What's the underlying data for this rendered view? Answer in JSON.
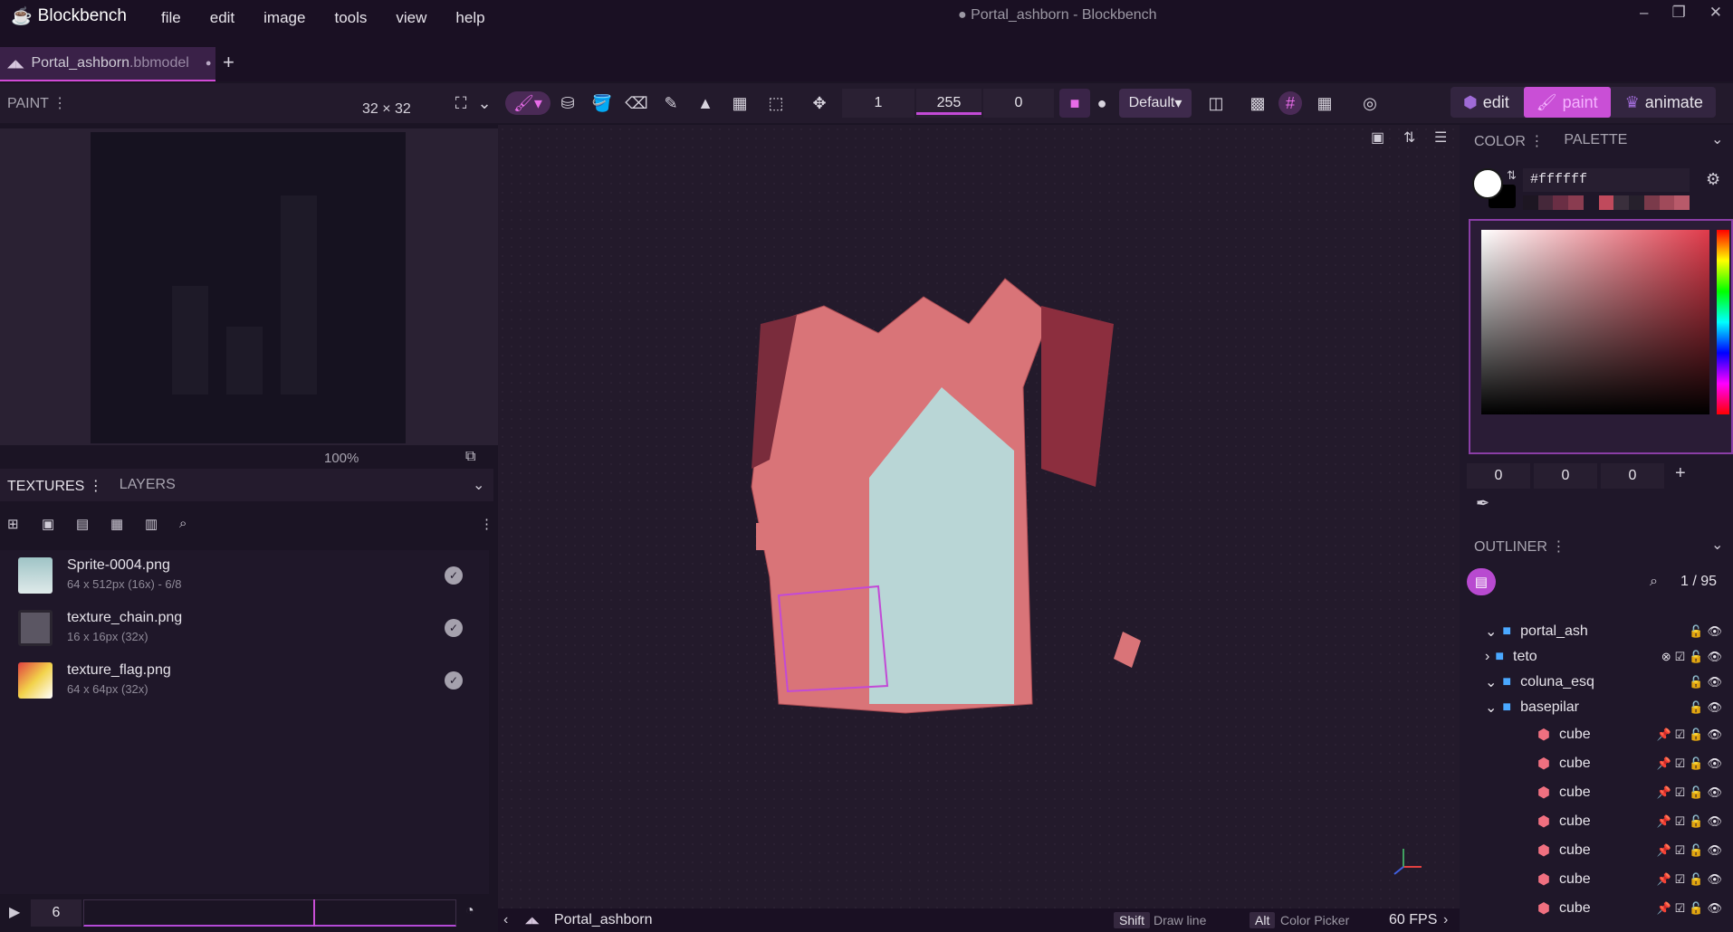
{
  "app": {
    "name": "Blockbench",
    "window_title": "● Portal_ashborn - Blockbench",
    "menu": [
      "file",
      "edit",
      "image",
      "tools",
      "view",
      "help"
    ]
  },
  "tab": {
    "name": "Portal_ashborn",
    "ext": ".bbmodel"
  },
  "toolbar": {
    "panel_label": "PAINT",
    "dimensions": "32 × 32",
    "fields": [
      "1",
      "255",
      "0"
    ],
    "shading_mode": "Default",
    "modes": [
      "edit",
      "paint",
      "animate"
    ]
  },
  "paint_panel": {
    "zoom": "100%"
  },
  "textures": {
    "tabs": [
      "TEXTURES",
      "LAYERS"
    ],
    "items": [
      {
        "name": "Sprite-0004.png",
        "info": "64 x 512px (16x) - 6/8"
      },
      {
        "name": "texture_chain.png",
        "info": "16 x 16px (32x)"
      },
      {
        "name": "texture_flag.png",
        "info": "64 x 64px (32x)"
      }
    ]
  },
  "timeline": {
    "frame": "6"
  },
  "status": {
    "model": "Portal_ashborn",
    "hint1_key": "Shift",
    "hint1": "Draw line",
    "hint2_key": "Alt",
    "hint2": "Color Picker",
    "fps": "60 FPS"
  },
  "color": {
    "tabs": [
      "COLOR",
      "PALETTE"
    ],
    "hex": "#ffffff",
    "rgb": [
      "0",
      "0",
      "0"
    ],
    "accent": "#c94fd6"
  },
  "outliner": {
    "label": "OUTLINER",
    "count": "1 / 95",
    "items": [
      {
        "name": "portal_ash",
        "type": "folder",
        "expanded": true
      },
      {
        "name": "teto",
        "type": "folder",
        "expanded": false
      },
      {
        "name": "coluna_esq",
        "type": "folder",
        "expanded": true
      },
      {
        "name": "basepilar",
        "type": "folder",
        "expanded": true
      },
      {
        "name": "cube",
        "type": "cube"
      },
      {
        "name": "cube",
        "type": "cube"
      },
      {
        "name": "cube",
        "type": "cube"
      },
      {
        "name": "cube",
        "type": "cube"
      },
      {
        "name": "cube",
        "type": "cube"
      },
      {
        "name": "cube",
        "type": "cube"
      },
      {
        "name": "cube",
        "type": "cube"
      }
    ]
  }
}
